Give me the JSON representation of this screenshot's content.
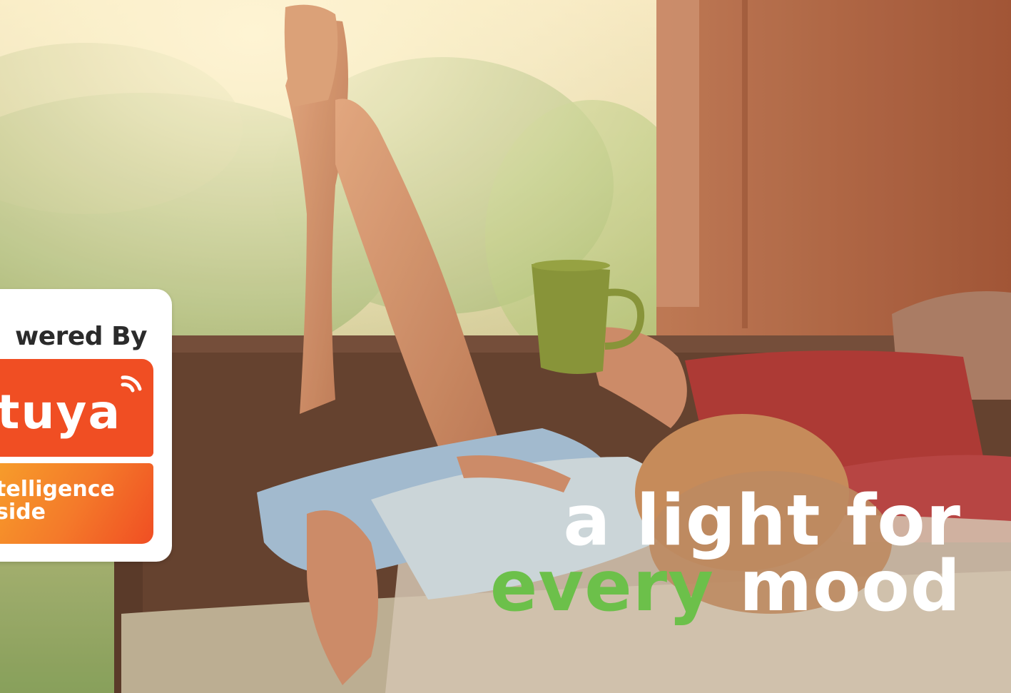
{
  "badge": {
    "title": "wered By",
    "logo": "tuya",
    "tagline": [
      "telligence",
      "side"
    ]
  },
  "headline": {
    "line1": "a light for",
    "accent_word": "every",
    "line2_rest": "mood"
  },
  "colors": {
    "brand_orange": "#f04e23",
    "accent_green": "#6cc04a"
  }
}
